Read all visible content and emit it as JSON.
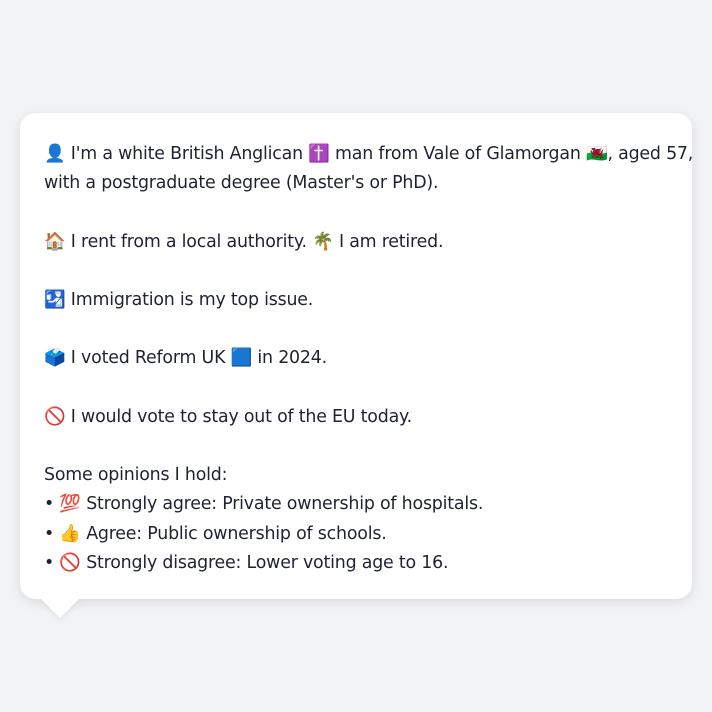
{
  "profile": {
    "identity": {
      "icon": "👤",
      "line1": "I'm a white British Anglican",
      "religion_icon": "✝️",
      "line1b": "man from Vale of Glamorgan",
      "flag_icon": "🏴󠁧󠁢󠁷󠁬󠁳󠁿",
      "line1c": ", aged 57,",
      "line2": "with a postgraduate degree (Master's or PhD)."
    },
    "housing": {
      "icon": "🏠",
      "text": "I rent from a local authority.",
      "work_icon": "🌴",
      "work_text": "I am retired."
    },
    "issue": {
      "icon": "🛂",
      "text": "Immigration is my top issue."
    },
    "vote": {
      "icon": "🗳️",
      "text_before": "I voted Reform UK",
      "party_icon": "🟦",
      "text_after": "in 2024."
    },
    "eu": {
      "icon": "🚫",
      "text": "I would vote to stay out of the EU today."
    },
    "opinions": {
      "heading": "Some opinions I hold:",
      "bullet": "•",
      "items": [
        {
          "icon": "💯",
          "text": "Strongly agree: Private ownership of hospitals."
        },
        {
          "icon": "👍",
          "text": "Agree: Public ownership of schools."
        },
        {
          "icon": "🚫",
          "text": "Strongly disagree: Lower voting age to 16."
        }
      ]
    }
  }
}
